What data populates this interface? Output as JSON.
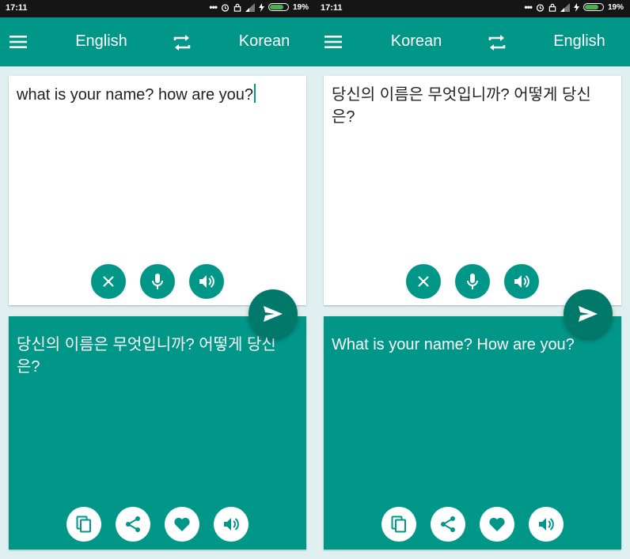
{
  "status_bar": {
    "time": "17:11",
    "battery_percent": "19%"
  },
  "screens": [
    {
      "source_lang": "English",
      "target_lang": "Korean",
      "input_text": "what is your name? how are you?",
      "output_text": "당신의 이름은 무엇입니까? 어떻게 당신은?",
      "show_caret": true
    },
    {
      "source_lang": "Korean",
      "target_lang": "English",
      "input_text": "당신의 이름은 무엇입니까? 어떻게 당신은?",
      "output_text": "What is your name? How are you?",
      "show_caret": false
    }
  ],
  "icons": {
    "menu": "hamburger-icon",
    "swap": "swap-arrows-icon",
    "clear": "close-icon",
    "mic": "microphone-icon",
    "speak": "speaker-icon",
    "send": "send-icon",
    "copy": "copy-icon",
    "share": "share-icon",
    "favorite": "heart-icon"
  },
  "colors": {
    "primary": "#009688",
    "fab": "#00796b",
    "background": "#e0f0f0"
  }
}
